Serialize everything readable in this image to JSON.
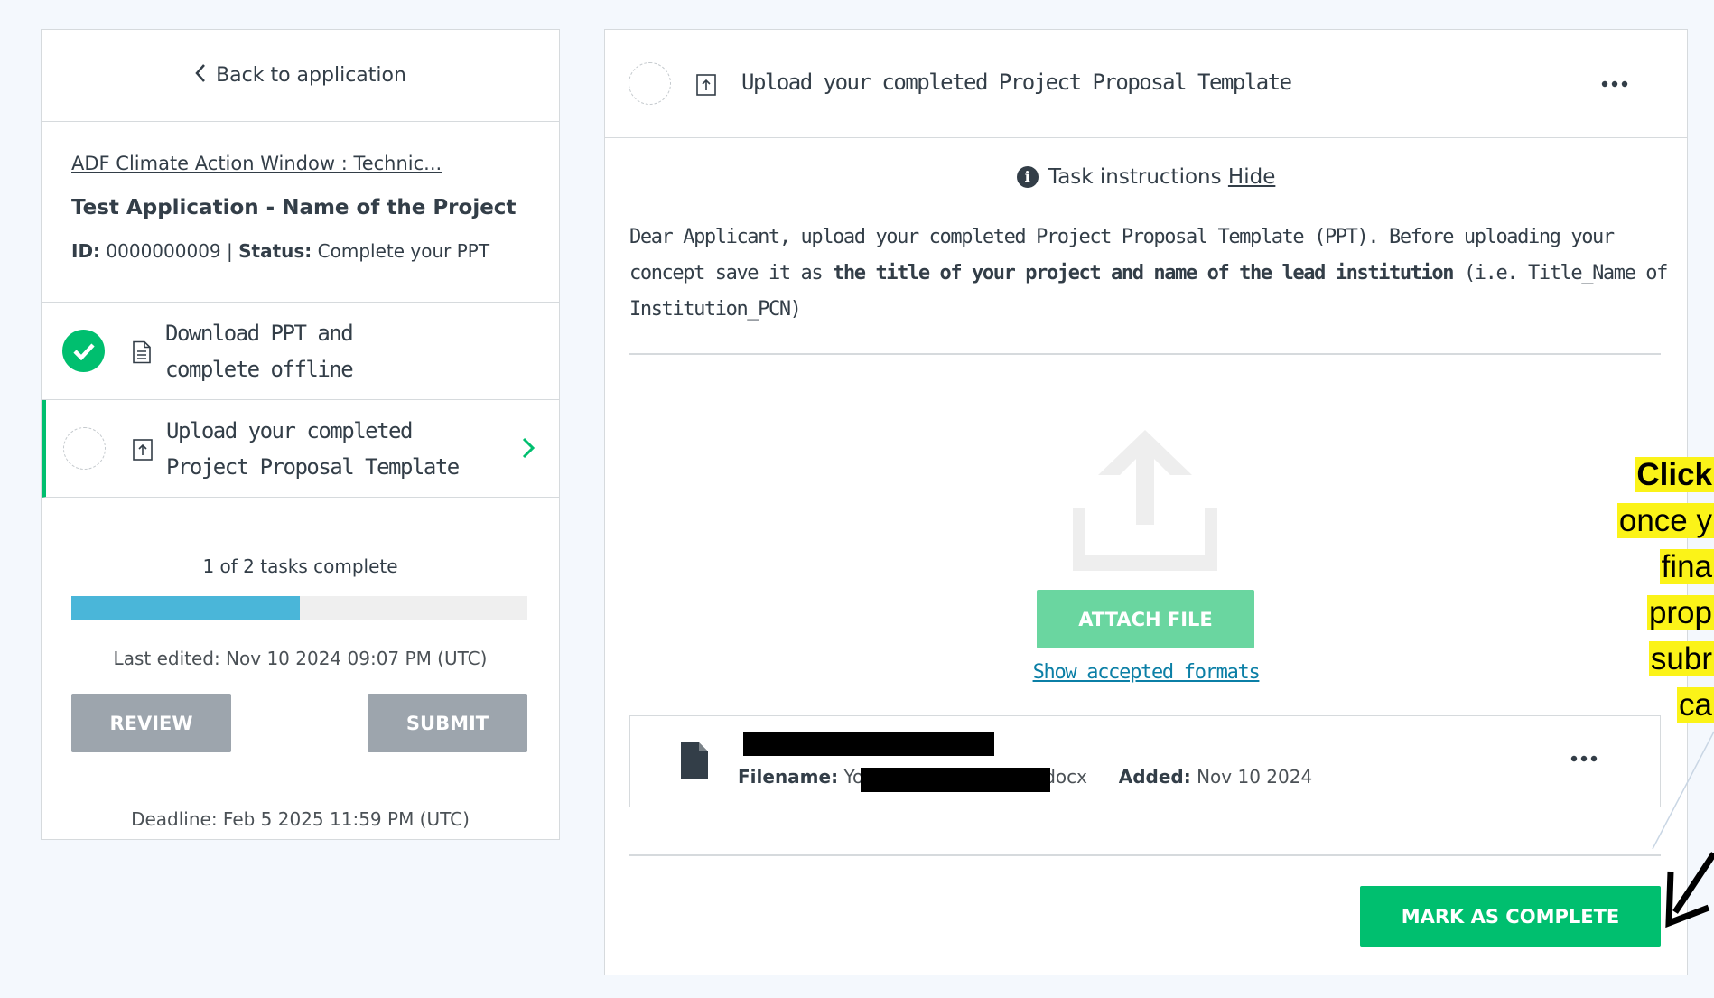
{
  "sidebar": {
    "back_label": "Back to application",
    "program_link": "ADF Climate Action Window : Technic...",
    "application_title": "Test Application - Name of the Project",
    "id_label": "ID:",
    "id_value": "0000000009",
    "separator": "|",
    "status_label": "Status:",
    "status_value": "Complete your PPT",
    "tasks": [
      {
        "line1": "Download PPT and",
        "line2": "complete offline",
        "state": "complete"
      },
      {
        "line1": "Upload your completed",
        "line2": "Project Proposal Template",
        "state": "active"
      }
    ],
    "progress_text": "1 of 2 tasks complete",
    "progress_fraction": 0.5,
    "last_edited": "Last edited: Nov 10 2024 09:07 PM (UTC)",
    "review_label": "REVIEW",
    "submit_label": "SUBMIT",
    "deadline": "Deadline: Feb 5 2025 11:59 PM (UTC)"
  },
  "task_panel": {
    "title": "Upload your completed Project Proposal Template",
    "instructions_label": "Task instructions",
    "hide_label": "Hide",
    "instructions_part1": "Dear Applicant, upload your completed Project Proposal Template (PPT). Before uploading your concept save it as ",
    "instructions_bold": "the title of your project and name of the lead institution",
    "instructions_part2": " (i.e. Title_Name of Institution_PCN)",
    "attach_label": "ATTACH FILE",
    "formats_link": "Show accepted formats",
    "file": {
      "filename_label": "Filename:",
      "filename_visible_start": "Yo",
      "filename_visible_end": "docx",
      "added_label": "Added:",
      "added_value": "Nov 10 2024"
    },
    "complete_label": "MARK AS COMPLETE"
  },
  "annotation": {
    "lines": [
      "Click",
      "once y",
      "fina",
      "prop",
      "subr",
      "ca"
    ]
  },
  "icons": {
    "back": "chevron-left-icon",
    "task_complete": "check-circle-icon",
    "task_pending": "dashed-circle-icon",
    "download_task": "document-icon",
    "upload_task": "upload-box-icon",
    "info": "info-icon",
    "upload_area": "upload-arrow-icon",
    "file": "file-icon",
    "more": "more-horizontal-icon"
  },
  "colors": {
    "accent_green": "#00bf6f",
    "attach_green": "#6ad6a0",
    "progress_blue": "#4ab6d9",
    "disabled_grey": "#9da5ad",
    "link_blue": "#0b7fa6",
    "highlight_yellow": "#fbf318"
  }
}
